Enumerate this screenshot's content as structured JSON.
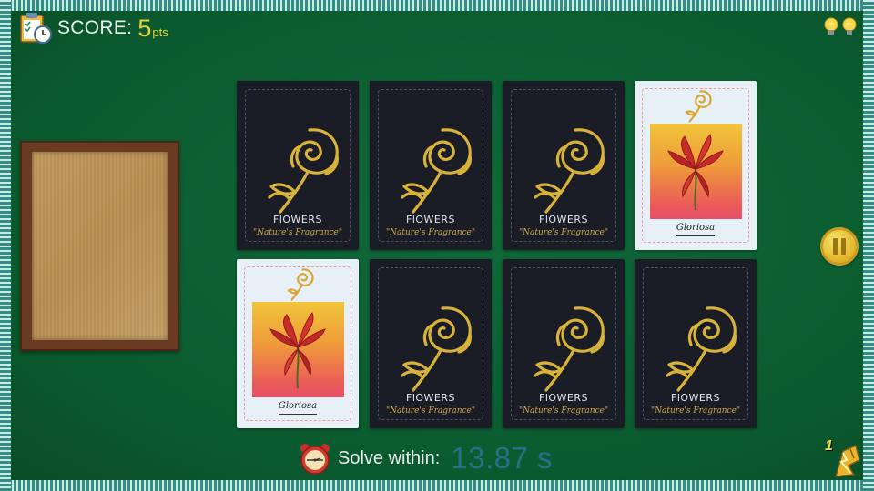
{
  "hud": {
    "score_label": "SCORE:",
    "score_value": "5",
    "score_unit": "pts",
    "hints_count": 2,
    "timer_label": "Solve within:",
    "timer_value": "13.87 s",
    "powerup_count": "1"
  },
  "cards": [
    {
      "state": "face-down",
      "title": "FlOWERS",
      "subtitle": "\"Nature's Fragrance\""
    },
    {
      "state": "face-down",
      "title": "FlOWERS",
      "subtitle": "\"Nature's Fragrance\""
    },
    {
      "state": "face-down",
      "title": "FlOWERS",
      "subtitle": "\"Nature's Fragrance\""
    },
    {
      "state": "face-up",
      "name": "Gloriosa"
    },
    {
      "state": "face-up",
      "name": "Gloriosa"
    },
    {
      "state": "face-down",
      "title": "FlOWERS",
      "subtitle": "\"Nature's Fragrance\""
    },
    {
      "state": "face-down",
      "title": "FlOWERS",
      "subtitle": "\"Nature's Fragrance\""
    },
    {
      "state": "face-down",
      "title": "FlOWERS",
      "subtitle": "\"Nature's Fragrance\""
    }
  ],
  "colors": {
    "felt": "#0c5a30",
    "card_back": "#1a1d25",
    "rose_gold": "#d9b23a",
    "score_accent": "#e6d23a",
    "timer_value": "#2c6e88"
  }
}
